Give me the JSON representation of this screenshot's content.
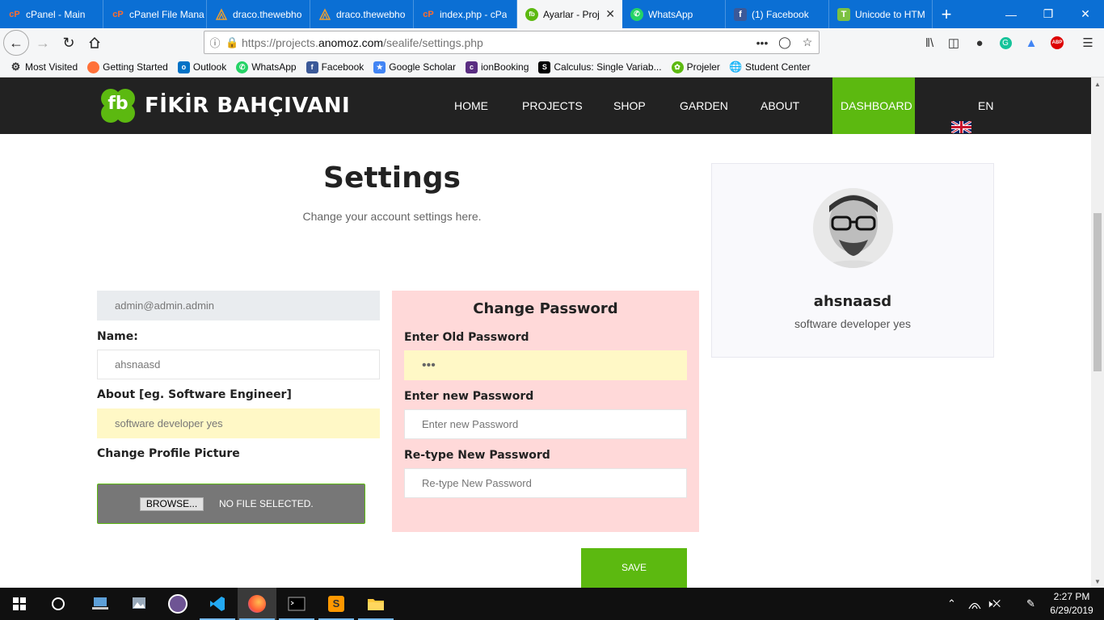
{
  "browser": {
    "tabs": [
      {
        "label": "cPanel - Main",
        "icon": "cpanel-icon"
      },
      {
        "label": "cPanel File Mana",
        "icon": "cpanel-icon"
      },
      {
        "label": "draco.thewebho",
        "icon": "draco-icon"
      },
      {
        "label": "draco.thewebho",
        "icon": "draco-icon"
      },
      {
        "label": "index.php - cPa",
        "icon": "cpanel-icon"
      },
      {
        "label": "Ayarlar - Proj",
        "icon": "fb-site-icon",
        "active": true
      },
      {
        "label": "WhatsApp",
        "icon": "whatsapp-icon"
      },
      {
        "label": "(1) Facebook",
        "icon": "facebook-icon"
      },
      {
        "label": "Unicode to HTM",
        "icon": "unicode-icon"
      }
    ],
    "url_prefix": "https://projects.",
    "url_host": "anomoz.com",
    "url_path": "/sealife/settings.php",
    "bookmarks": [
      {
        "label": "Most Visited",
        "icon": "gear-icon"
      },
      {
        "label": "Getting Started",
        "icon": "firefox-icon"
      },
      {
        "label": "Outlook",
        "icon": "outlook-icon"
      },
      {
        "label": "WhatsApp",
        "icon": "whatsapp-icon"
      },
      {
        "label": "Facebook",
        "icon": "facebook-icon"
      },
      {
        "label": "Google Scholar",
        "icon": "scholar-icon"
      },
      {
        "label": "ionBooking",
        "icon": "ionbooking-icon"
      },
      {
        "label": "Calculus: Single Variab...",
        "icon": "calculus-icon"
      },
      {
        "label": "Projeler",
        "icon": "projeler-icon"
      },
      {
        "label": "Student Center",
        "icon": "globe-icon"
      }
    ]
  },
  "site": {
    "brand": "FİKİR BAHÇIVANI",
    "brand_mark": "fb",
    "nav": {
      "home": "HOME",
      "projects": "PROJECTS",
      "shop": "SHOP",
      "garden": "GARDEN",
      "about": "ABOUT",
      "dashboard": "DASHBOARD",
      "language": "EN"
    },
    "colors": {
      "accent": "#5cb910",
      "header": "#222222",
      "password_panel": "#ffd9d9"
    }
  },
  "settings": {
    "title": "Settings",
    "subtitle": "Change your account settings here.",
    "email_value": "admin@admin.admin",
    "name_label": "Name:",
    "name_value": "ahsnaasd",
    "about_label": "About [eg. Software Engineer]",
    "about_value": "software developer yes",
    "picture_label": "Change Profile Picture",
    "browse_label": "BROWSE...",
    "no_file_label": "NO FILE SELECTED.",
    "save_label": "SAVE"
  },
  "password": {
    "title": "Change Password",
    "old_label": "Enter Old Password",
    "old_value": "•••",
    "new_label": "Enter new Password",
    "new_placeholder": "Enter new Password",
    "retype_label": "Re-type New Password",
    "retype_placeholder": "Re-type New Password"
  },
  "profile": {
    "name": "ahsnaasd",
    "about": "software developer yes"
  },
  "taskbar": {
    "time": "2:27 PM",
    "date": "6/29/2019"
  }
}
